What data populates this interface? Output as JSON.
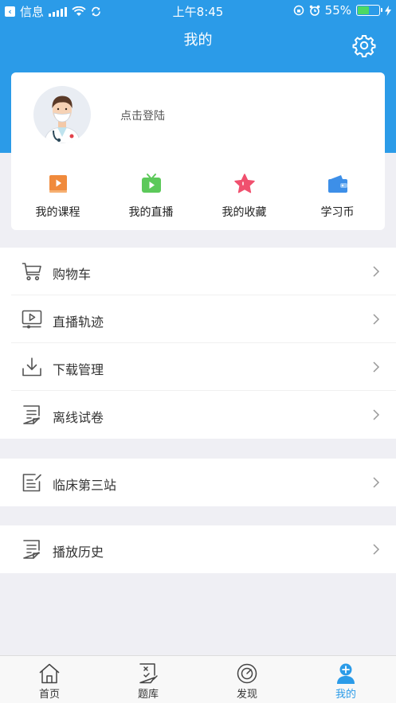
{
  "status_bar": {
    "carrier": "信息",
    "time": "上午8:45",
    "battery_percent": "55%",
    "battery_level": 0.55
  },
  "header": {
    "title": "我的",
    "settings_icon": "gear-icon"
  },
  "profile": {
    "login_prompt": "点击登陆",
    "avatar_icon": "doctor-avatar"
  },
  "quick_actions": [
    {
      "label": "我的课程",
      "icon": "course-book-icon",
      "color": "#f08a3c"
    },
    {
      "label": "我的直播",
      "icon": "live-tv-icon",
      "color": "#5cc95a"
    },
    {
      "label": "我的收藏",
      "icon": "star-icon",
      "color": "#f0506e"
    },
    {
      "label": "学习币",
      "icon": "wallet-icon",
      "color": "#3d8fe8"
    }
  ],
  "menu_groups": [
    {
      "items": [
        {
          "label": "购物车",
          "icon": "cart-icon"
        },
        {
          "label": "直播轨迹",
          "icon": "live-track-icon"
        },
        {
          "label": "下载管理",
          "icon": "download-icon"
        },
        {
          "label": "离线试卷",
          "icon": "offline-paper-icon"
        }
      ]
    },
    {
      "items": [
        {
          "label": "临床第三站",
          "icon": "clinical-station-icon"
        }
      ]
    },
    {
      "items": [
        {
          "label": "播放历史",
          "icon": "history-icon"
        }
      ]
    }
  ],
  "tabbar": {
    "tabs": [
      {
        "label": "首页",
        "icon": "home-icon"
      },
      {
        "label": "题库",
        "icon": "question-bank-icon"
      },
      {
        "label": "发现",
        "icon": "discover-icon"
      },
      {
        "label": "我的",
        "icon": "profile-icon",
        "active": true
      }
    ]
  },
  "colors": {
    "primary": "#2b9be8",
    "background": "#efeff4"
  }
}
